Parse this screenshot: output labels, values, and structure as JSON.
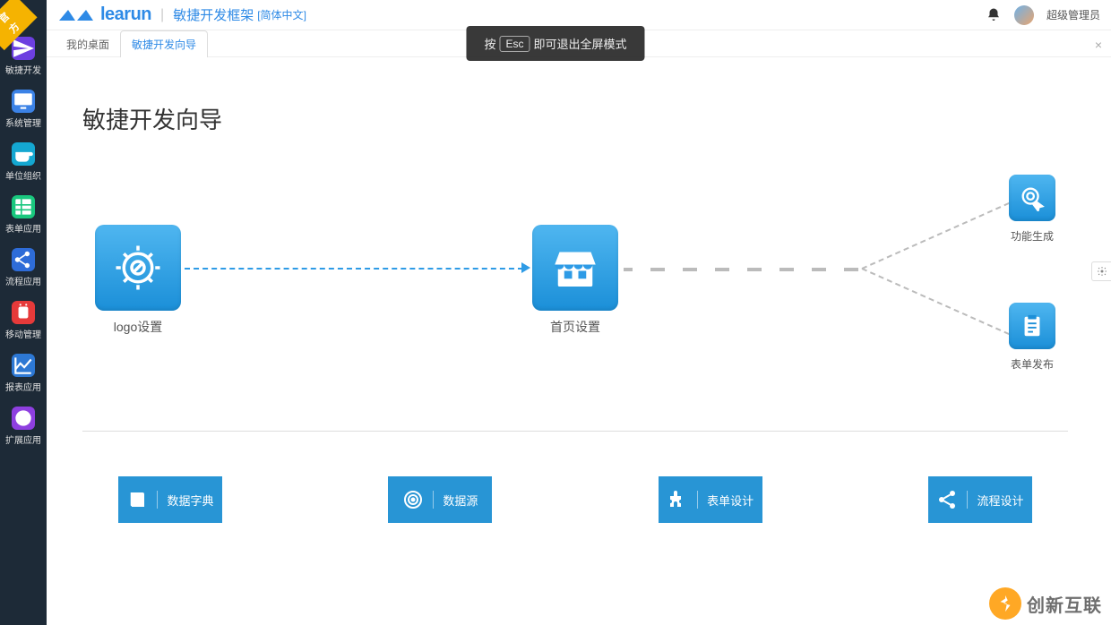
{
  "official_badge": "官方",
  "logo_text": "learun",
  "app_title": "敏捷开发框架",
  "lang_switch_left": "[",
  "lang_switch": "简体中文",
  "lang_switch_right": "]",
  "user_name": "超级管理员",
  "fullscreen_hint_pre": "按",
  "fullscreen_esc": "Esc",
  "fullscreen_hint_post": "即可退出全屏模式",
  "tabs": [
    {
      "label": "我的桌面",
      "active": false
    },
    {
      "label": "敏捷开发向导",
      "active": true
    }
  ],
  "sidebar": [
    {
      "label": "敏捷开发",
      "color": "#6c3fe0",
      "icon": "paper-plane"
    },
    {
      "label": "系统管理",
      "color": "#3b82e6",
      "icon": "monitor"
    },
    {
      "label": "单位组织",
      "color": "#14a7d1",
      "icon": "coffee"
    },
    {
      "label": "表单应用",
      "color": "#19c77e",
      "icon": "grid"
    },
    {
      "label": "流程应用",
      "color": "#2e6cd8",
      "icon": "share"
    },
    {
      "label": "移动管理",
      "color": "#e63a3a",
      "icon": "android"
    },
    {
      "label": "报表应用",
      "color": "#2d78d4",
      "icon": "chart"
    },
    {
      "label": "扩展应用",
      "color": "#8e3fe0",
      "icon": "globe"
    }
  ],
  "page_title": "敏捷开发向导",
  "wizard": {
    "logo": "logo设置",
    "home": "首页设置",
    "funcgen": "功能生成",
    "formpub": "表单发布"
  },
  "cards": [
    {
      "label": "数据字典",
      "icon": "book"
    },
    {
      "label": "数据源",
      "icon": "target"
    },
    {
      "label": "表单设计",
      "icon": "puzzle"
    },
    {
      "label": "流程设计",
      "icon": "share2"
    }
  ],
  "watermark_text": "创新互联"
}
